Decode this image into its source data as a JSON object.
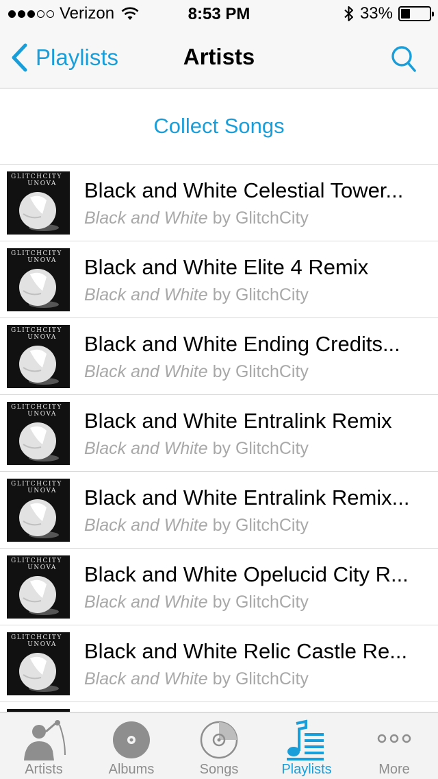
{
  "status_bar": {
    "carrier": "Verizon",
    "signal_bars_filled": 3,
    "signal_bars_total": 5,
    "time": "8:53 PM",
    "battery_percent": "33%",
    "battery_level": 0.33
  },
  "nav": {
    "back_label": "Playlists",
    "title": "Artists",
    "accent_color": "#1a9ed9"
  },
  "collect_label": "Collect Songs",
  "artwork": {
    "line1": "GLITCHCITY",
    "line2": "UNOVA"
  },
  "songs": [
    {
      "title": "Black and White Celestial Tower...",
      "album": "Black and White",
      "by": "by",
      "artist": "GlitchCity"
    },
    {
      "title": "Black and White Elite 4 Remix",
      "album": "Black and White",
      "by": "by",
      "artist": "GlitchCity"
    },
    {
      "title": "Black and White Ending Credits...",
      "album": "Black and White",
      "by": "by",
      "artist": "GlitchCity"
    },
    {
      "title": "Black and White Entralink Remix",
      "album": "Black and White",
      "by": "by",
      "artist": "GlitchCity"
    },
    {
      "title": "Black and White Entralink Remix...",
      "album": "Black and White",
      "by": "by",
      "artist": "GlitchCity"
    },
    {
      "title": "Black and White Opelucid City R...",
      "album": "Black and White",
      "by": "by",
      "artist": "GlitchCity"
    },
    {
      "title": "Black and White Relic Castle Re...",
      "album": "Black and White",
      "by": "by",
      "artist": "GlitchCity"
    }
  ],
  "tabs": [
    {
      "label": "Artists",
      "icon": "artist-silhouette-icon"
    },
    {
      "label": "Albums",
      "icon": "album-disc-icon"
    },
    {
      "label": "Songs",
      "icon": "song-disc-icon"
    },
    {
      "label": "Playlists",
      "icon": "playlist-icon",
      "active": true
    },
    {
      "label": "More",
      "icon": "more-dots-icon"
    }
  ]
}
